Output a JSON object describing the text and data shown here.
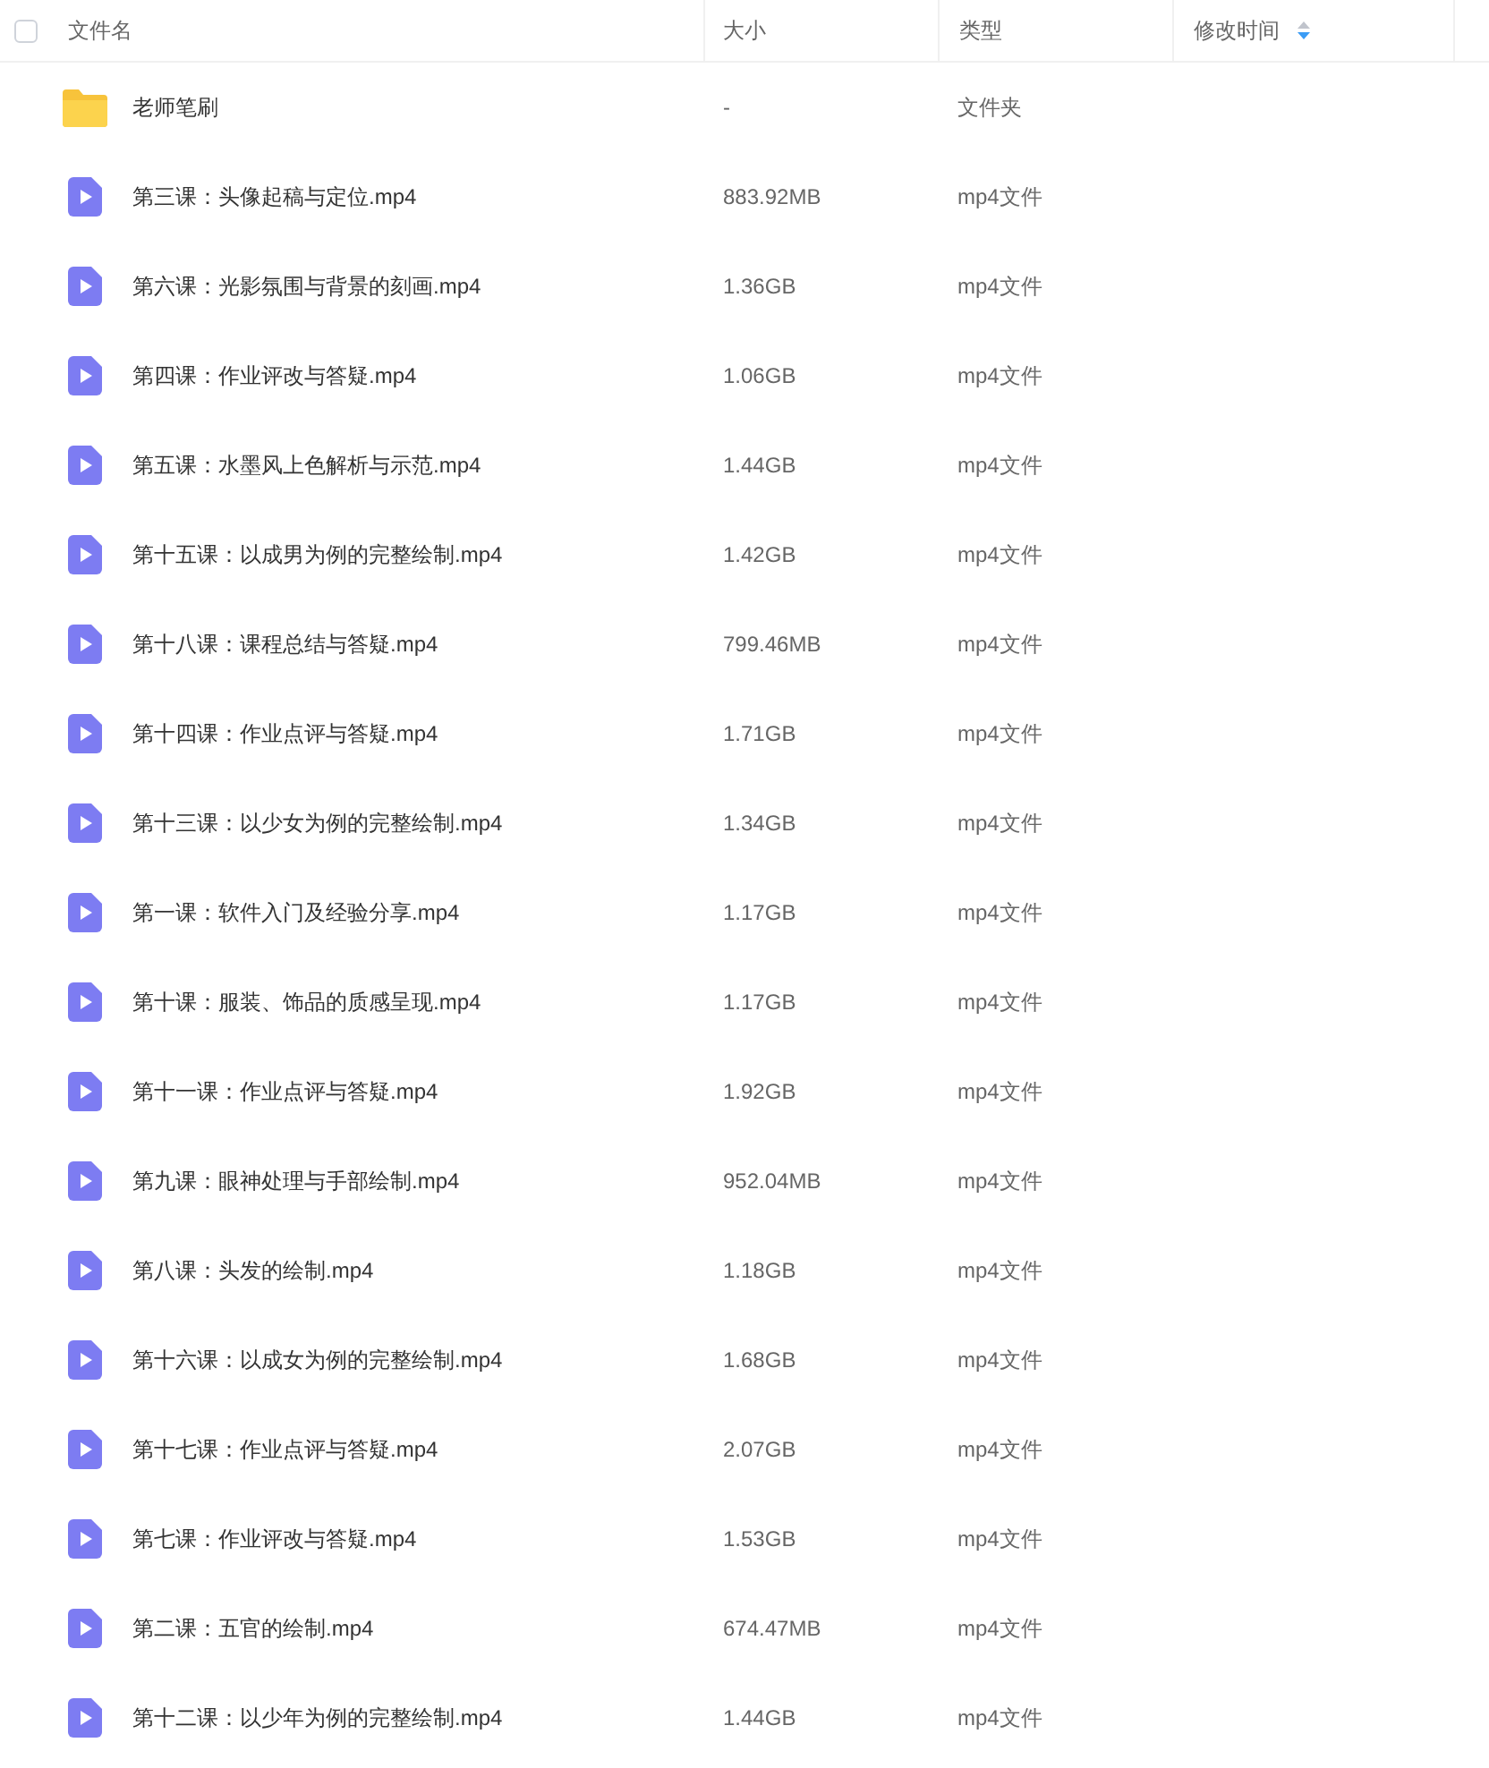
{
  "header": {
    "select_all": {
      "checked": false
    },
    "columns": [
      {
        "label": "文件名"
      },
      {
        "label": "大小"
      },
      {
        "label": "类型"
      },
      {
        "label": "修改时间",
        "sorted": true
      }
    ]
  },
  "rows": [
    {
      "kind": "folder",
      "name": "老师笔刷",
      "size": "-",
      "type": "文件夹"
    },
    {
      "kind": "video",
      "name": "第三课：头像起稿与定位.mp4",
      "size": "883.92MB",
      "type": "mp4文件"
    },
    {
      "kind": "video",
      "name": "第六课：光影氛围与背景的刻画.mp4",
      "size": "1.36GB",
      "type": "mp4文件"
    },
    {
      "kind": "video",
      "name": "第四课：作业评改与答疑.mp4",
      "size": "1.06GB",
      "type": "mp4文件"
    },
    {
      "kind": "video",
      "name": "第五课：水墨风上色解析与示范.mp4",
      "size": "1.44GB",
      "type": "mp4文件"
    },
    {
      "kind": "video",
      "name": "第十五课：以成男为例的完整绘制.mp4",
      "size": "1.42GB",
      "type": "mp4文件"
    },
    {
      "kind": "video",
      "name": "第十八课：课程总结与答疑.mp4",
      "size": "799.46MB",
      "type": "mp4文件"
    },
    {
      "kind": "video",
      "name": "第十四课：作业点评与答疑.mp4",
      "size": "1.71GB",
      "type": "mp4文件"
    },
    {
      "kind": "video",
      "name": "第十三课：以少女为例的完整绘制.mp4",
      "size": "1.34GB",
      "type": "mp4文件"
    },
    {
      "kind": "video",
      "name": "第一课：软件入门及经验分享.mp4",
      "size": "1.17GB",
      "type": "mp4文件"
    },
    {
      "kind": "video",
      "name": "第十课：服装、饰品的质感呈现.mp4",
      "size": "1.17GB",
      "type": "mp4文件"
    },
    {
      "kind": "video",
      "name": "第十一课：作业点评与答疑.mp4",
      "size": "1.92GB",
      "type": "mp4文件"
    },
    {
      "kind": "video",
      "name": "第九课：眼神处理与手部绘制.mp4",
      "size": "952.04MB",
      "type": "mp4文件"
    },
    {
      "kind": "video",
      "name": "第八课：头发的绘制.mp4",
      "size": "1.18GB",
      "type": "mp4文件"
    },
    {
      "kind": "video",
      "name": "第十六课：以成女为例的完整绘制.mp4",
      "size": "1.68GB",
      "type": "mp4文件"
    },
    {
      "kind": "video",
      "name": "第十七课：作业点评与答疑.mp4",
      "size": "2.07GB",
      "type": "mp4文件"
    },
    {
      "kind": "video",
      "name": "第七课：作业评改与答疑.mp4",
      "size": "1.53GB",
      "type": "mp4文件"
    },
    {
      "kind": "video",
      "name": "第二课：五官的绘制.mp4",
      "size": "674.47MB",
      "type": "mp4文件"
    },
    {
      "kind": "video",
      "name": "第十二课：以少年为例的完整绘制.mp4",
      "size": "1.44GB",
      "type": "mp4文件"
    }
  ]
}
